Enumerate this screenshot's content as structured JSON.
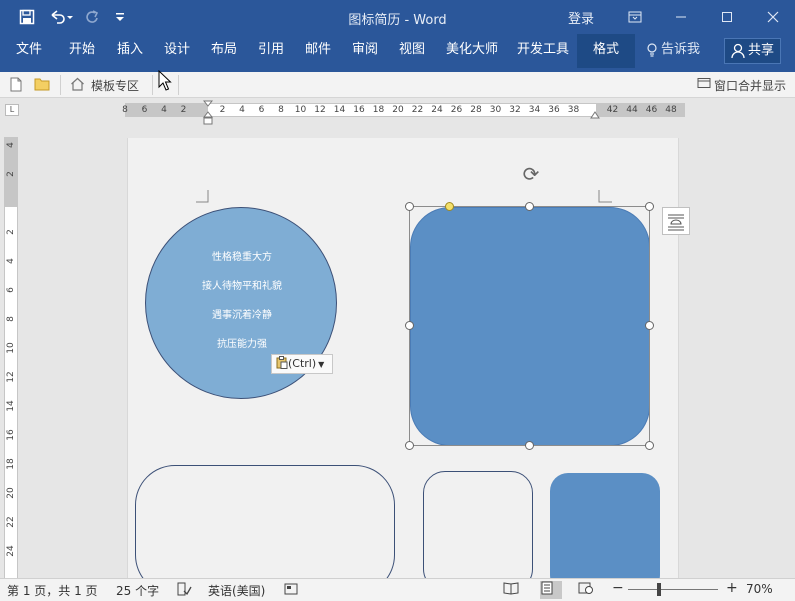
{
  "titlebar": {
    "title": "图标简历  -  Word",
    "login": "登录",
    "qa_save_icon": "save-icon",
    "qa_undo_icon": "undo-icon",
    "qa_redo_icon": "redo-icon",
    "qa_customize_icon": "customize-icon"
  },
  "ribbon": {
    "tabs": [
      "文件",
      "开始",
      "插入",
      "设计",
      "布局",
      "引用",
      "邮件",
      "审阅",
      "视图",
      "美化大师",
      "开发工具",
      "格式"
    ],
    "active_tab": "格式",
    "tell_me": "告诉我",
    "share": "共享"
  },
  "strip": {
    "template_zone": "模板专区",
    "merge_windows": "窗口合并显示"
  },
  "ruler": {
    "h_numbers": [
      "8",
      "6",
      "4",
      "2",
      "",
      "2",
      "4",
      "6",
      "8",
      "10",
      "12",
      "14",
      "16",
      "18",
      "20",
      "22",
      "24",
      "26",
      "28",
      "30",
      "32",
      "34",
      "36",
      "38",
      "",
      "42",
      "44",
      "46",
      "48"
    ],
    "v_numbers": [
      "4",
      "2",
      "",
      "2",
      "4",
      "6",
      "8",
      "10",
      "12",
      "14",
      "16",
      "18",
      "20",
      "22",
      "24"
    ]
  },
  "document": {
    "circle_lines": [
      "性格稳重大方",
      "接人待物平和礼貌",
      "遇事沉着冷静",
      "抗压能力强"
    ],
    "paste_label": "(Ctrl)"
  },
  "status": {
    "page": "第 1 页，共 1 页",
    "words": "25 个字",
    "language": "英语(美国)",
    "zoom": "70%",
    "zoom_minus": "−",
    "zoom_plus": "+"
  },
  "colors": {
    "brand": "#2b579a",
    "shape_fill": "#5b8fc5",
    "circle_fill": "#7fadd4",
    "outline": "#3c5077"
  }
}
